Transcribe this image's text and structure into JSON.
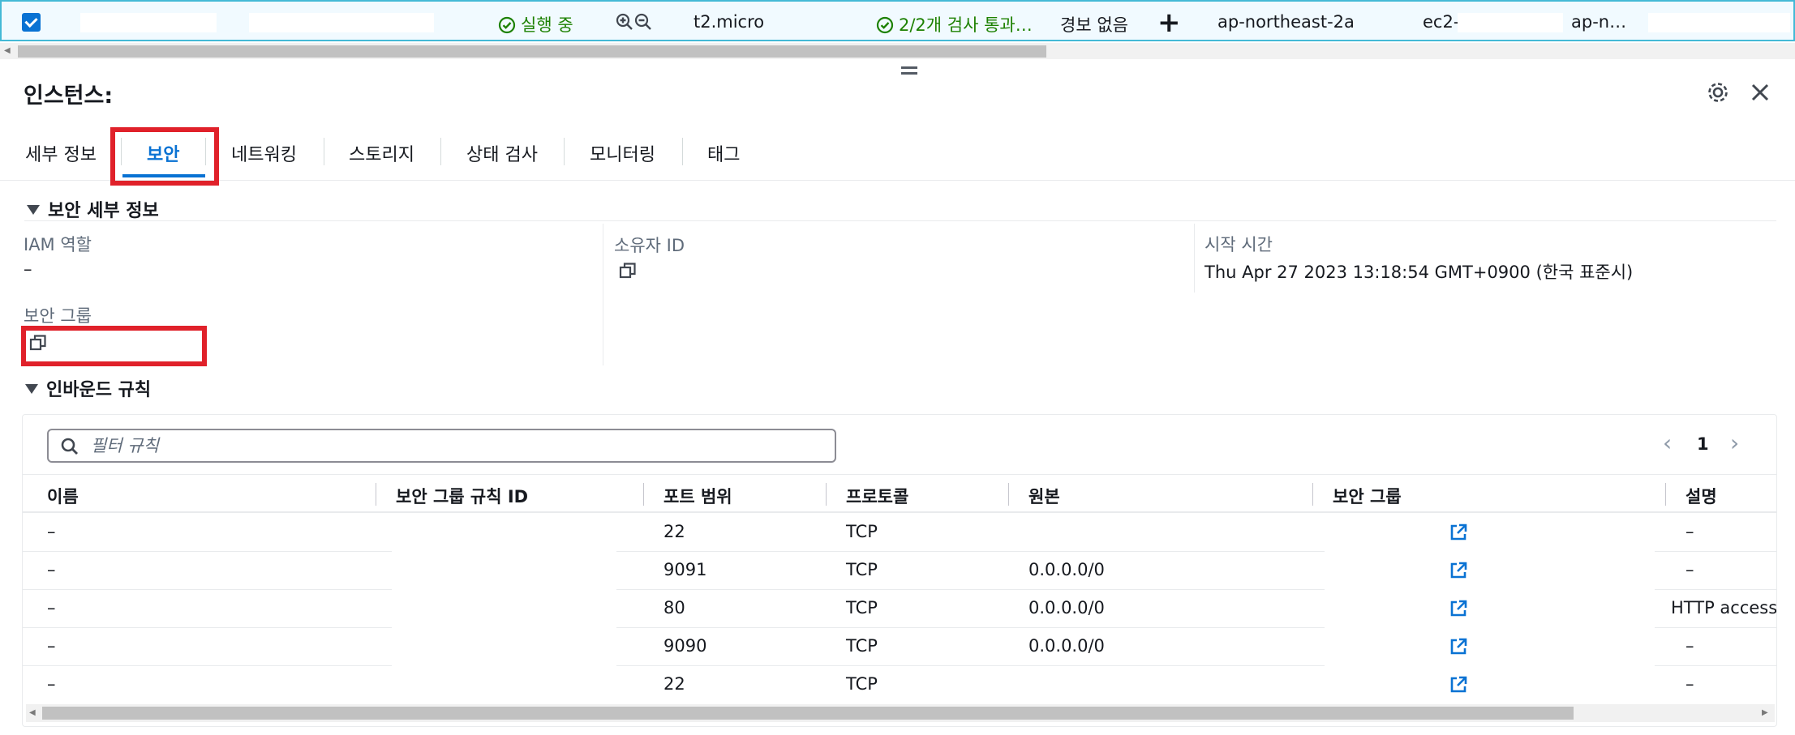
{
  "instance_row": {
    "state": "실행 중",
    "instance_type": "t2.micro",
    "status_check": "2/2개 검사 통과…",
    "alarm_status": "경보 없음",
    "add_alarm_symbol": "+",
    "availability_zone": "ap-northeast-2a",
    "public_dns": "ec2-",
    "region_short": "ap-n…"
  },
  "panel": {
    "title": "인스턴스:",
    "tabs": [
      {
        "label": "세부 정보"
      },
      {
        "label": "보안"
      },
      {
        "label": "네트워킹"
      },
      {
        "label": "스토리지"
      },
      {
        "label": "상태 검사"
      },
      {
        "label": "모니터링"
      },
      {
        "label": "태그"
      }
    ],
    "active_tab": "보안"
  },
  "security_details": {
    "heading": "보안 세부 정보",
    "iam_role_label": "IAM 역할",
    "iam_role_value": "–",
    "owner_id_label": "소유자 ID",
    "launch_time_label": "시작 시간",
    "launch_time_value": "Thu Apr 27 2023 13:18:54 GMT+0900 (한국 표준시)",
    "security_groups_label": "보안 그룹"
  },
  "inbound_rules": {
    "heading": "인바운드 규칙",
    "filter_placeholder": "필터 규칙",
    "page": "1",
    "columns": [
      "이름",
      "보안 그룹 규칙 ID",
      "포트 범위",
      "프로토콜",
      "원본",
      "보안 그룹",
      "설명"
    ],
    "rows": [
      {
        "name": "–",
        "port": "22",
        "protocol": "TCP",
        "source": "",
        "description": "–"
      },
      {
        "name": "–",
        "port": "9091",
        "protocol": "TCP",
        "source": "0.0.0.0/0",
        "description": "–"
      },
      {
        "name": "–",
        "port": "80",
        "protocol": "TCP",
        "source": "0.0.0.0/0",
        "description": "HTTP access"
      },
      {
        "name": "–",
        "port": "9090",
        "protocol": "TCP",
        "source": "0.0.0.0/0",
        "description": "–"
      },
      {
        "name": "–",
        "port": "22",
        "protocol": "TCP",
        "source": "",
        "description": "–"
      }
    ]
  },
  "colors": {
    "accent": "#0972d3",
    "success": "#1d8102",
    "highlight": "#e0212a",
    "selected_row_border": "#44b9d6"
  }
}
